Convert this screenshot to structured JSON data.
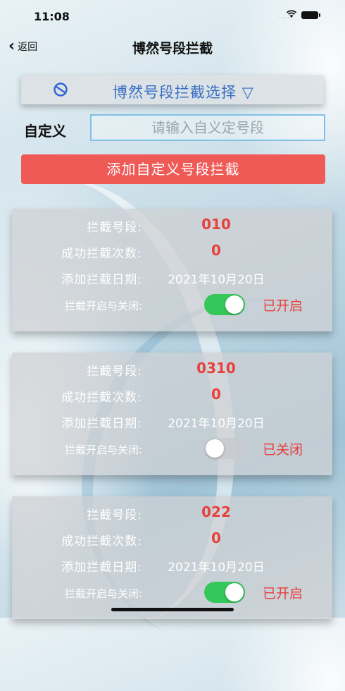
{
  "status_bar": {
    "time": "11:08",
    "signal_dots": "....."
  },
  "nav": {
    "back_label": "返回",
    "title": "博然号段拦截"
  },
  "selector": {
    "label": "博然号段拦截选择 ▽"
  },
  "custom": {
    "label": "自定义",
    "placeholder": "请输入自义定号段",
    "value": ""
  },
  "add_button": {
    "label": "添加自定义号段拦截"
  },
  "field_labels": {
    "segment": "拦截号段:",
    "count": "成功拦截次数:",
    "date": "添加拦截日期:",
    "toggle": "拦截开启与关闭:"
  },
  "cards": [
    {
      "segment": "010",
      "count": "0",
      "date": "2021年10月20日",
      "enabled": true,
      "state_text": "已开启"
    },
    {
      "segment": "0310",
      "count": "0",
      "date": "2021年10月20日",
      "enabled": false,
      "state_text": "已关闭"
    },
    {
      "segment": "022",
      "count": "0",
      "date": "2021年10月20日",
      "enabled": true,
      "state_text": "已开启"
    }
  ],
  "colors": {
    "accent_red": "#ef5a57",
    "toggle_on": "#34c759",
    "selector_text": "#3a6fc4"
  }
}
